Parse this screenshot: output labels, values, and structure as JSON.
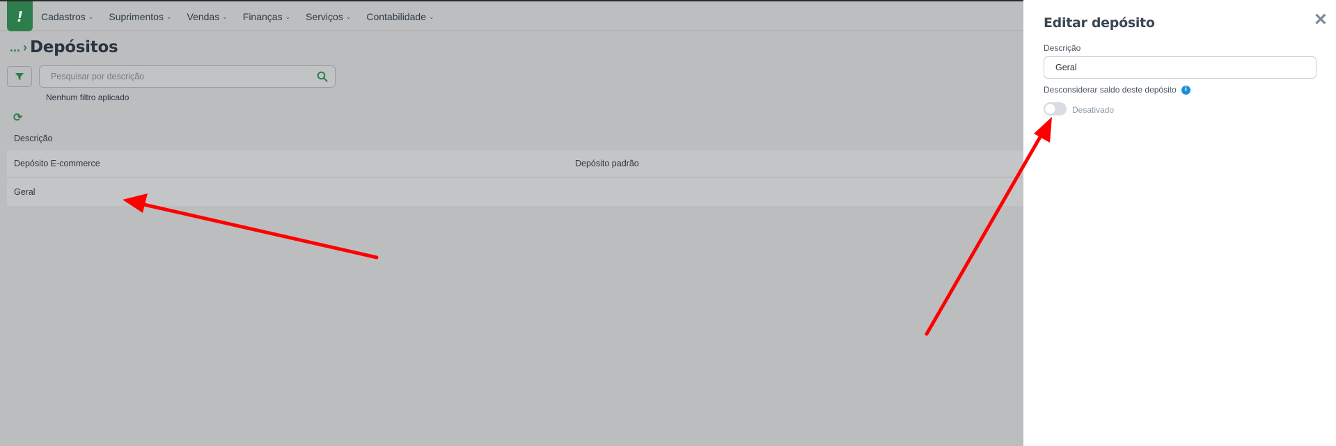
{
  "brand": {
    "logo_glyph": "!",
    "color": "#2e7d4d"
  },
  "menu": [
    {
      "label": "Cadastros"
    },
    {
      "label": "Suprimentos"
    },
    {
      "label": "Vendas"
    },
    {
      "label": "Finanças"
    },
    {
      "label": "Serviços"
    },
    {
      "label": "Contabilidade"
    }
  ],
  "breadcrumb": {
    "ellipsis": "...",
    "title": "Depósitos"
  },
  "search": {
    "placeholder": "Pesquisar por descrição"
  },
  "filters_note": "Nenhum filtro aplicado",
  "column_filter_label": "Descrição",
  "table": {
    "headers": [
      "Depósito E-commerce",
      "Depósito padrão"
    ],
    "rows": [
      {
        "descricao": "Geral"
      }
    ]
  },
  "panel": {
    "title": "Editar depósito",
    "field_label": "Descrição",
    "field_value": "Geral",
    "toggle_label": "Desconsiderar saldo deste depósito",
    "toggle_state": "Desativado",
    "toggle_on": false
  },
  "annotation_color": "#ff0000"
}
